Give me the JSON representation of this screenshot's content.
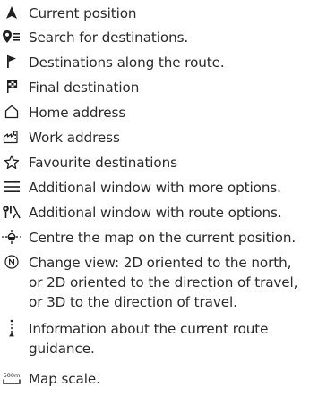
{
  "legend": {
    "items": [
      {
        "icon": "arrow-up-icon",
        "text": "Current position"
      },
      {
        "icon": "search-destination-icon",
        "text": "Search for destinations."
      },
      {
        "icon": "flag-icon",
        "text": "Destinations along the route."
      },
      {
        "icon": "checkered-flag-icon",
        "text": "Final destination"
      },
      {
        "icon": "home-icon",
        "text": "Home address"
      },
      {
        "icon": "work-icon",
        "text": "Work address"
      },
      {
        "icon": "star-icon",
        "text": "Favourite destinations"
      },
      {
        "icon": "menu-icon",
        "text": "Additional window with more options."
      },
      {
        "icon": "route-options-icon",
        "text": "Additional window with route options."
      },
      {
        "icon": "center-map-icon",
        "text": "Centre the map on the current position."
      },
      {
        "icon": "compass-icon",
        "text": "Change view: 2D oriented to the north,\nor 2D oriented to the direction of travel,\nor 3D to the direction of travel."
      },
      {
        "icon": "route-info-icon",
        "text": "Information about the current route\nguidance."
      },
      {
        "icon": "map-scale-icon",
        "icon_label": "500m",
        "text": "Map scale."
      }
    ]
  }
}
